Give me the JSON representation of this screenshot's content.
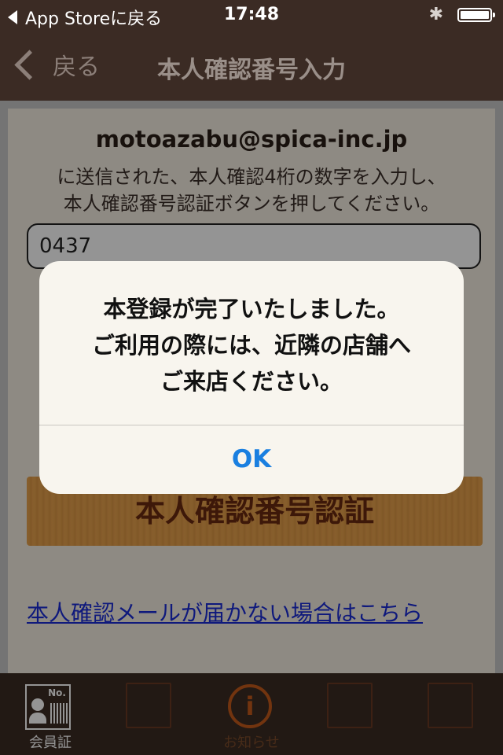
{
  "status_bar": {
    "back_app": "App Storeに戻る",
    "time": "17:48"
  },
  "nav": {
    "back_label": "戻る",
    "title": "本人確認番号入力"
  },
  "form": {
    "email": "motoazabu@spica-inc.jp",
    "instruction_line1": "に送信された、本人確認4桁の数字を入力し、",
    "instruction_line2": "本人確認番号認証ボタンを押してください。",
    "code_value": "0437",
    "verify_button": "本人確認番号認証",
    "help_link": "本人確認メールが届かない場合はこちら"
  },
  "tabbar": {
    "items": [
      {
        "label": "会員証"
      },
      {
        "label": ""
      },
      {
        "label": "お知らせ"
      },
      {
        "label": ""
      },
      {
        "label": ""
      }
    ],
    "card_no": "No."
  },
  "alert": {
    "line1": "本登録が完了いたしました。",
    "line2": "ご利用の際には、近隣の店舗へ",
    "line3": "ご来店ください。",
    "ok": "OK"
  },
  "colors": {
    "bar_bg": "#3b2b24",
    "link": "#1a2cd6",
    "alert_button": "#1a7fe0",
    "verify_button": "#e8a24e"
  }
}
